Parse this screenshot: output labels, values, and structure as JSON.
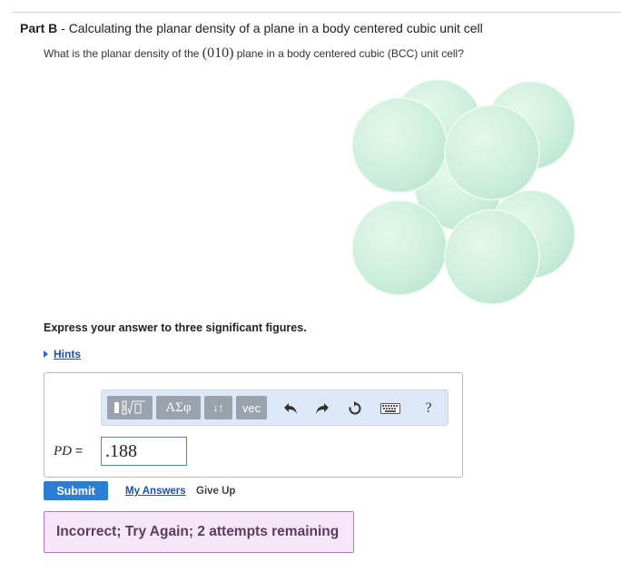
{
  "part": {
    "label": "Part B",
    "separator": " - ",
    "title": "Calculating the planar density of a plane in a body centered cubic unit cell"
  },
  "question": {
    "before": "What is the planar density of the ",
    "plane": "(010)",
    "after": " plane in a body centered cubic (BCC) unit cell?"
  },
  "diagram": {
    "icon": "bcc-unit-cell-spheres",
    "sphere_color": "#cdeedd"
  },
  "instruction": "Express your answer to three significant figures.",
  "hints": {
    "label": "Hints"
  },
  "toolbar": {
    "templates_icon": "fraction-sqrt-template-icon",
    "greek_label": "ΑΣφ",
    "arrows_label": "↓↑",
    "vec_label": "vec",
    "help_label": "?"
  },
  "answer": {
    "variable": "PD",
    "equals": " =",
    "value": ".188"
  },
  "actions": {
    "submit": "Submit",
    "my_answers": "My Answers",
    "give_up": "Give Up"
  },
  "feedback": {
    "message": "Incorrect; Try Again; 2 attempts remaining",
    "status_color": "#5a3d5e"
  },
  "colors": {
    "accent": "#2a7ed3",
    "link": "#1c4fa8",
    "toolbar_bg": "#dce8f7",
    "feedback_bg": "#f6e7f8"
  }
}
